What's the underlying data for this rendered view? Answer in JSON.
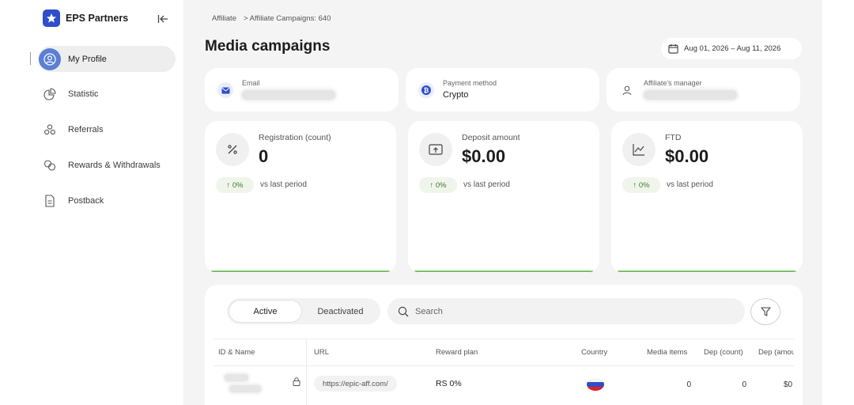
{
  "brand": {
    "name": "EPS Partners"
  },
  "sidebar": {
    "items": [
      {
        "label": "My Profile",
        "icon": "user-circle-icon"
      },
      {
        "label": "Statistic",
        "icon": "pie-chart-icon"
      },
      {
        "label": "Referrals",
        "icon": "users-icon"
      },
      {
        "label": "Rewards & Withdrawals",
        "icon": "exchange-icon"
      },
      {
        "label": "Postback",
        "icon": "document-icon"
      }
    ]
  },
  "breadcrumb": {
    "parent": "Affiliate",
    "current": "> Affiliate Campaigns: 640"
  },
  "page": {
    "title": "Media campaigns"
  },
  "date_range": {
    "label": "Aug 01, 2026 – Aug 11, 2026"
  },
  "info_cards": {
    "email": {
      "label": "Email"
    },
    "payment": {
      "label": "Payment method",
      "value": "Crypto"
    },
    "manager": {
      "label": "Affiliate's manager"
    }
  },
  "stats": [
    {
      "label": "Registration (count)",
      "value": "0",
      "change": "↑ 0%",
      "compare": "vs last period",
      "icon": "percent-icon"
    },
    {
      "label": "Deposit amount",
      "value": "$0.00",
      "change": "↑ 0%",
      "compare": "vs last period",
      "icon": "deposit-icon"
    },
    {
      "label": "FTD",
      "value": "$0.00",
      "change": "↑ 0%",
      "compare": "vs last period",
      "icon": "line-chart-icon"
    }
  ],
  "tabs": {
    "active": "Active",
    "inactive": "Deactivated"
  },
  "search": {
    "placeholder": "Search"
  },
  "table": {
    "columns": [
      "ID & Name",
      "URL",
      "Reward plan",
      "Country",
      "Media items",
      "Dep (count)",
      "Dep (amou"
    ],
    "rows": [
      {
        "url": "https://epic-aff.com/",
        "reward_plan": "RS 0%",
        "country_flag": "russia-flag",
        "media_items": "0",
        "dep_count": "0",
        "dep_amount": "$0"
      }
    ]
  },
  "colors": {
    "accent": "#2f4ec9",
    "positive": "#3f7a2a",
    "progress_line": "#7cbf6a"
  }
}
